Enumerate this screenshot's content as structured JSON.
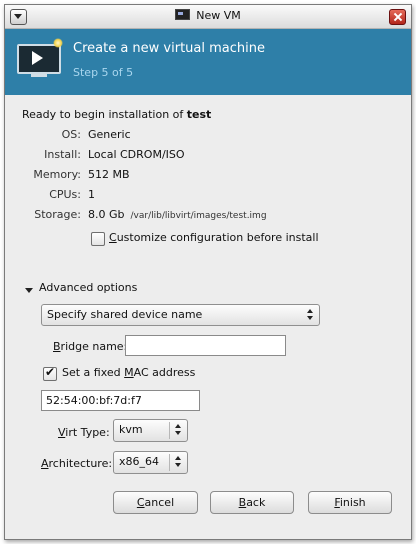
{
  "window": {
    "title": "New VM"
  },
  "banner": {
    "title": "Create a new virtual machine",
    "step": "Step 5 of 5"
  },
  "summary": {
    "ready_prefix": "Ready to begin installation of ",
    "vm_name": "test",
    "rows": [
      {
        "label": "OS:",
        "value": "Generic"
      },
      {
        "label": "Install:",
        "value": "Local CDROM/ISO"
      },
      {
        "label": "Memory:",
        "value": "512 MB"
      },
      {
        "label": "CPUs:",
        "value": "1"
      },
      {
        "label": "Storage:",
        "value": "8.0 Gb",
        "path": "/var/lib/libvirt/images/test.img"
      }
    ],
    "customize": {
      "mnemonic": "C",
      "rest": "ustomize configuration before install",
      "checked": false
    }
  },
  "advanced": {
    "label": "Advanced options",
    "network_select": "Specify shared device name",
    "bridge": {
      "mnemonic": "B",
      "rest": "ridge name:",
      "value": ""
    },
    "fixed_mac": {
      "prefix": "Set a fixed ",
      "mnemonic": "M",
      "rest": "AC address",
      "checked": true
    },
    "mac_value": "52:54:00:bf:7d:f7",
    "virt_type": {
      "mnemonic": "V",
      "rest": "irt Type:",
      "value": "kvm"
    },
    "architecture": {
      "mnemonic": "A",
      "rest": "rchitecture:",
      "value": "x86_64"
    }
  },
  "buttons": {
    "cancel": {
      "mnemonic": "C",
      "rest": "ancel"
    },
    "back": {
      "mnemonic": "B",
      "rest": "ack"
    },
    "finish": {
      "mnemonic": "F",
      "rest": "inish"
    }
  },
  "colors": {
    "banner": "#2e7fa8",
    "step_text": "#a9d6ee"
  },
  "icons": [
    "window-menu-icon",
    "vm-icon",
    "close-icon",
    "virtual-machine-monitor-icon",
    "expander-icon"
  ]
}
